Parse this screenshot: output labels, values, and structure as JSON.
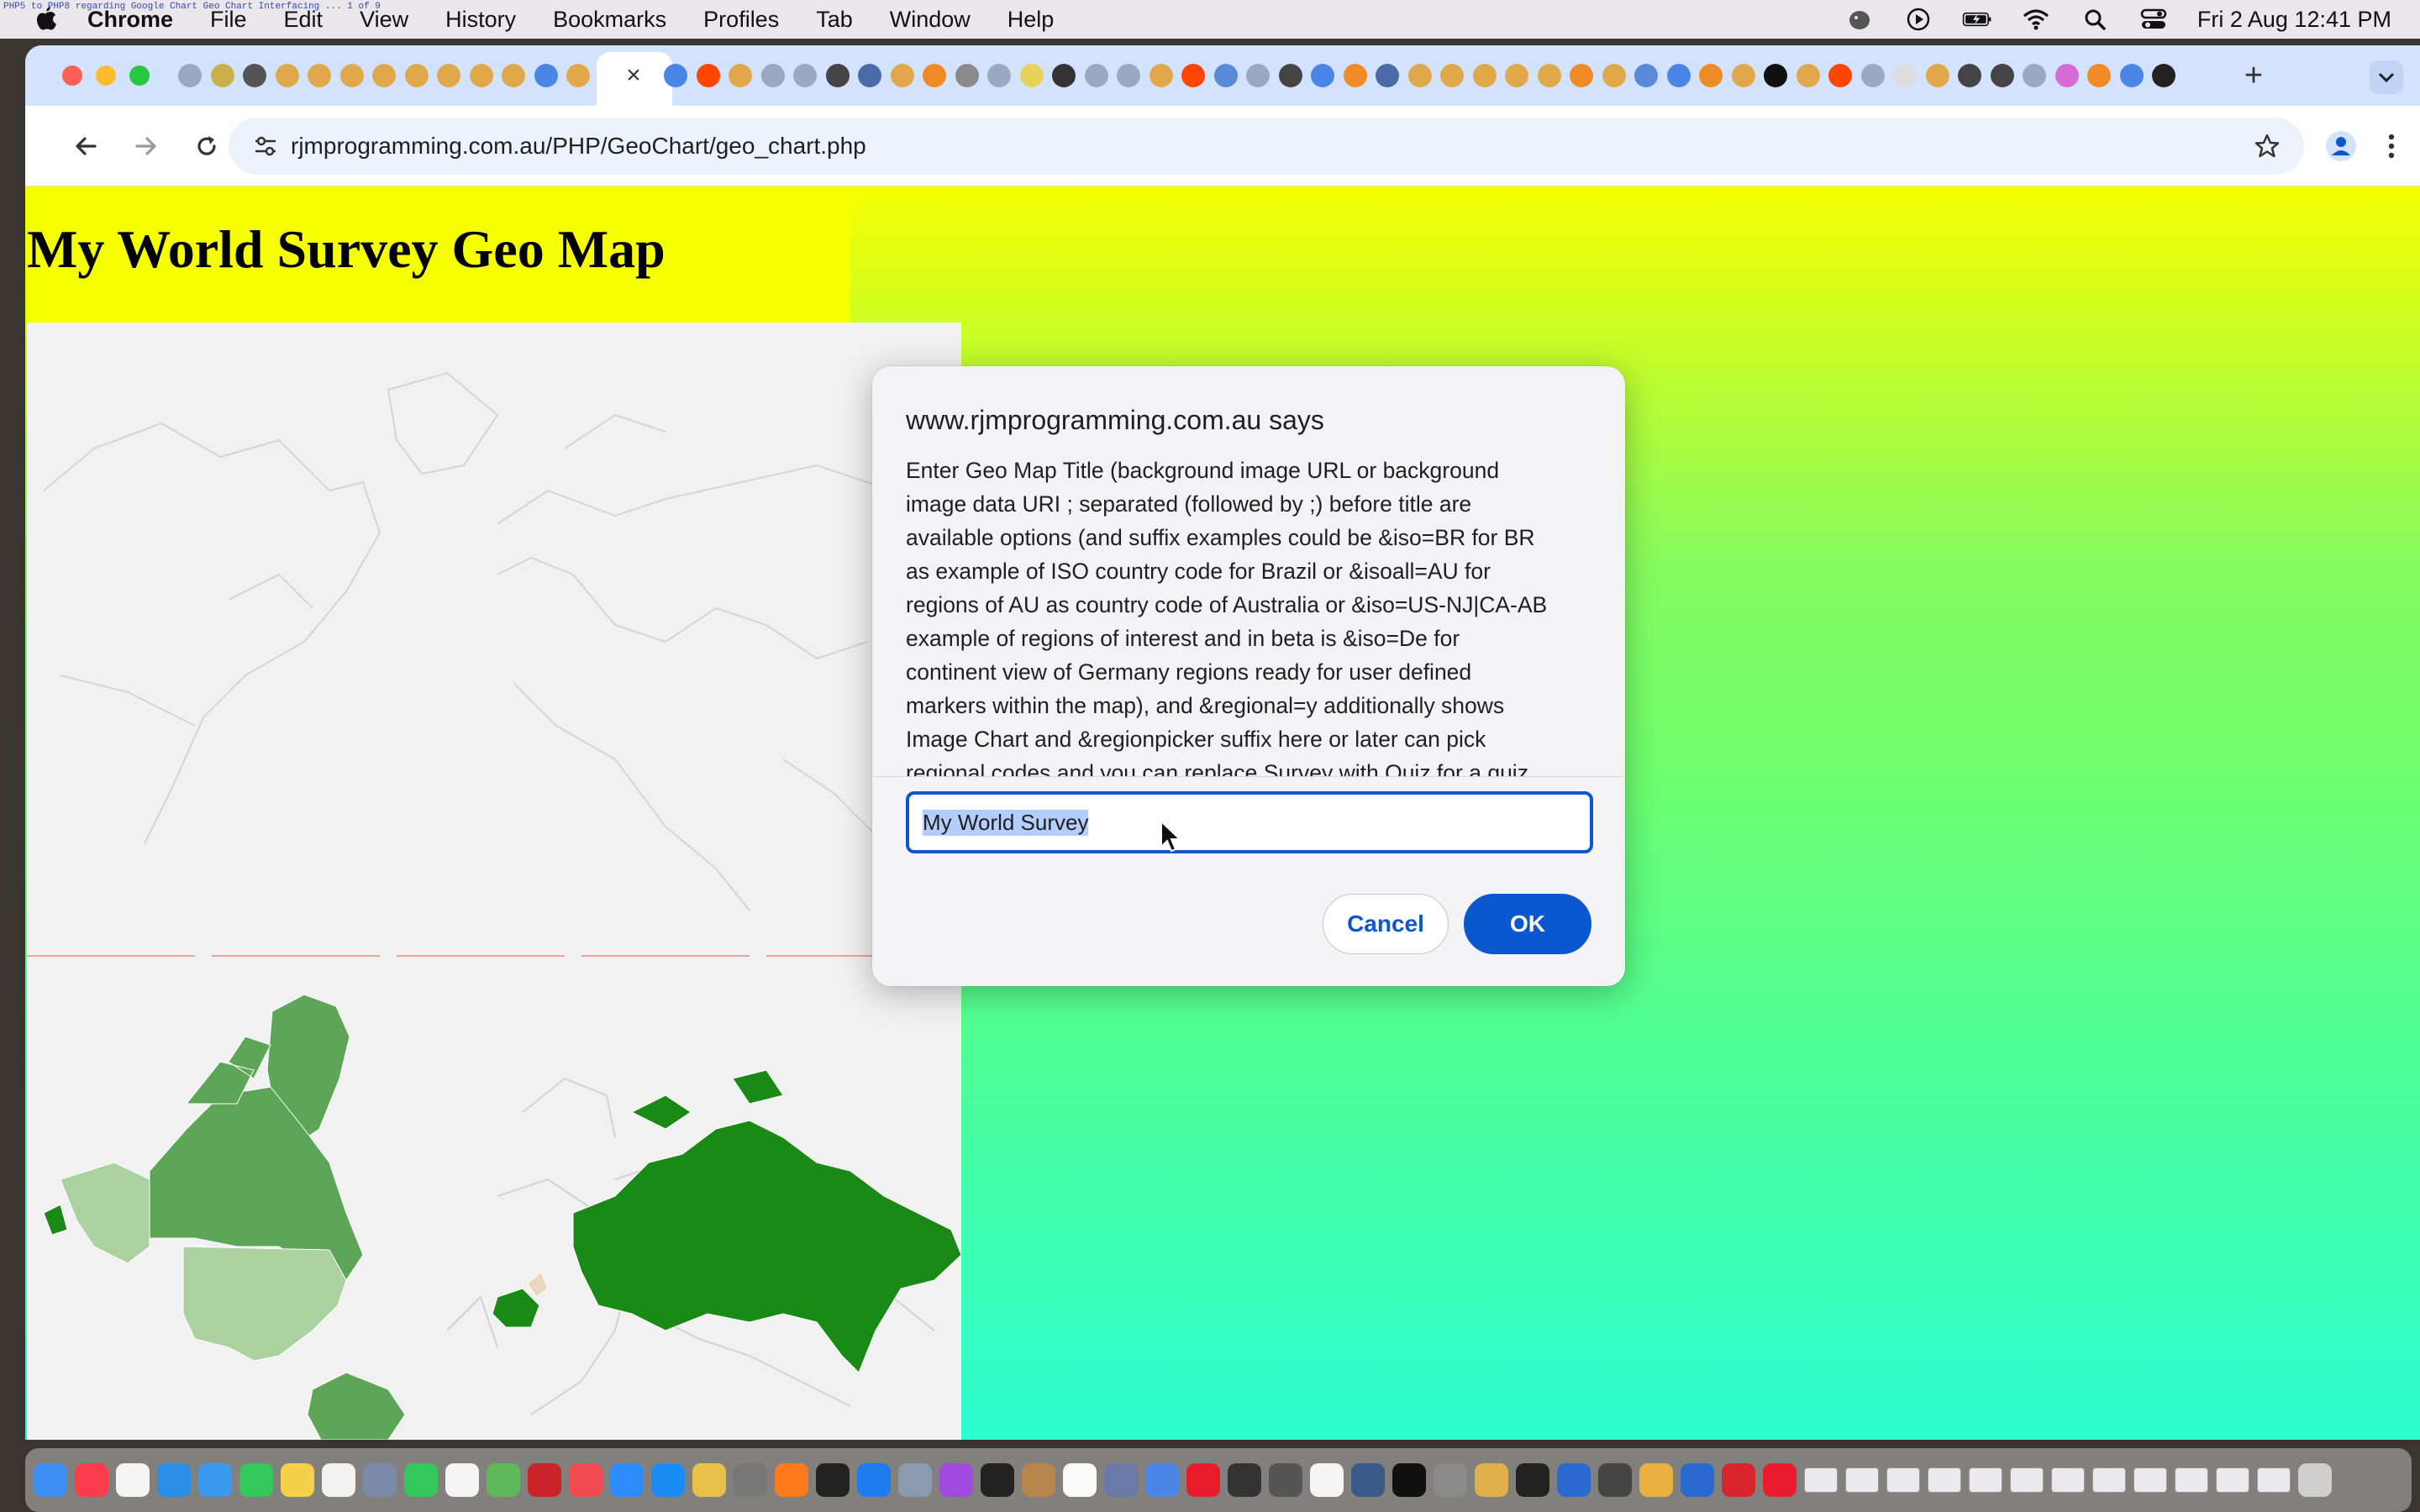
{
  "menubar": {
    "app_name": "Chrome",
    "items": [
      "File",
      "Edit",
      "View",
      "History",
      "Bookmarks",
      "Profiles",
      "Tab",
      "Window",
      "Help"
    ],
    "ghost_text": "PHP5 to PHP8 regarding Google Chart Geo Chart Interfacing ... 1 of 9",
    "clock": "Fri 2 Aug  12:41 PM"
  },
  "browser": {
    "url": "rjmprogramming.com.au/PHP/GeoChart/geo_chart.php",
    "tab_close": "×",
    "new_tab": "+"
  },
  "page": {
    "heading": "My World Survey Geo Map"
  },
  "dialog": {
    "title": "www.rjmprogramming.com.au says",
    "message": "Enter Geo Map Title (background image URL or background\nimage data URI ; separated (followed by ;) before title are\navailable options (and suffix examples could be &iso=BR for BR\nas example of ISO country code for Brazil or &isoall=AU for\nregions of AU as country code of Australia or &iso=US-NJ|CA-AB\nexample of regions of interest and in beta is &iso=De for\ncontinent view of Germany regions ready for user defined\nmarkers within the map), and &regional=y additionally shows\nImage Chart and &regionpicker suffix here or later can pick\nregional codes and you can replace Survey with Quiz for a quiz",
    "input_value": "My World Survey",
    "cancel_label": "Cancel",
    "ok_label": "OK"
  },
  "icons": {
    "apple": "apple-icon",
    "status": [
      "evernote-icon",
      "play-icon",
      "battery-icon",
      "wifi-icon",
      "spotlight-icon",
      "control-center-icon"
    ],
    "toolbar": [
      "back-icon",
      "forward-icon",
      "reload-icon",
      "site-info-icon",
      "bookmark-star-icon",
      "profile-icon",
      "kebab-menu-icon"
    ]
  },
  "colors": {
    "accent": "#0b57d0",
    "tab_strip": "#d3e3fd",
    "page_yellow": "#f6ff00",
    "page_green": "#6ffe6d",
    "page_cyan": "#2dfdd2",
    "map_dark": "#1a8a17",
    "map_mid": "#5ea657",
    "map_light": "#abd1a0"
  }
}
